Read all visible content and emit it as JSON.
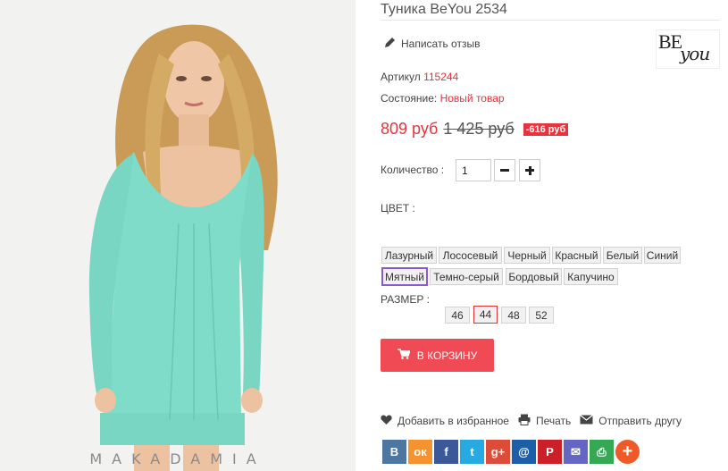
{
  "product": {
    "title": "Туника BeYou 2534",
    "brand_logo_be": "BE",
    "brand_logo_you": "you",
    "watermark": "MAKADAMIA"
  },
  "review": {
    "label": "Написать отзыв"
  },
  "sku": {
    "label": "Артикул",
    "value": "115244"
  },
  "condition": {
    "label": "Состояние:",
    "value": "Новый товар"
  },
  "price": {
    "current": "809 руб",
    "old": "1 425 руб",
    "discount": "-616 руб"
  },
  "quantity": {
    "label": "Количество :",
    "value": "1",
    "minus": "−",
    "plus": "+"
  },
  "color": {
    "label": "ЦВЕТ :",
    "options": [
      "Лазурный",
      "Лососевый",
      "Черный",
      "Красный",
      "Белый",
      "Синий",
      "Мятный",
      "Темно-серый",
      "Бордовый",
      "Капучино"
    ],
    "selected": "Мятный"
  },
  "size": {
    "label": "РАЗМЕР :",
    "options": [
      "46",
      "44",
      "48",
      "52"
    ],
    "selected": "44"
  },
  "cart": {
    "label": "В КОРЗИНУ"
  },
  "actions": {
    "wishlist": "Добавить в избранное",
    "print": "Печать",
    "send": "Отправить другу"
  },
  "share": {
    "vk": "В",
    "ok": "ок",
    "fb": "f",
    "tw": "t",
    "gp": "g+",
    "mail_ru": "@",
    "pin": "P",
    "email": "✉",
    "printer": "⎙",
    "more": "+"
  },
  "colors": {
    "accent": "#e5343d",
    "cart": "#f04a55",
    "dress": "#7fdcc9"
  }
}
